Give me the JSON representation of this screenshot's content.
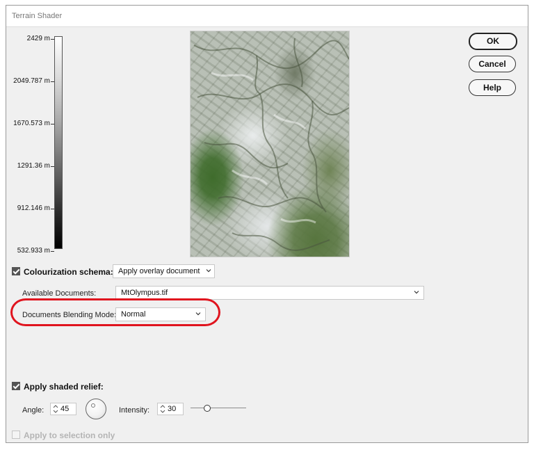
{
  "window": {
    "title": "Terrain Shader"
  },
  "elevation_scale": {
    "labels": [
      "2429 m",
      "2049.787 m",
      "1670.573 m",
      "1291.36 m",
      "912.146 m",
      "532.933 m"
    ]
  },
  "buttons": {
    "ok": "OK",
    "cancel": "Cancel",
    "help": "Help"
  },
  "colourization": {
    "checked": true,
    "label": "Colourization schema:",
    "schema_value": "Apply overlay document",
    "available_documents_label": "Available Documents:",
    "available_documents_value": "MtOlympus.tif",
    "blending_mode_label": "Documents Blending Mode:",
    "blending_mode_value": "Normal"
  },
  "shaded_relief": {
    "checked": true,
    "label": "Apply shaded relief:",
    "angle_label": "Angle:",
    "angle_value": "45",
    "intensity_label": "Intensity:",
    "intensity_value": "30",
    "intensity_level_fraction": 0.3
  },
  "selection_only": {
    "checked": false,
    "enabled": false,
    "label": "Apply to selection only"
  },
  "colors": {
    "highlight": "#e0141e",
    "dialog_bg": "#f0f0f0"
  }
}
